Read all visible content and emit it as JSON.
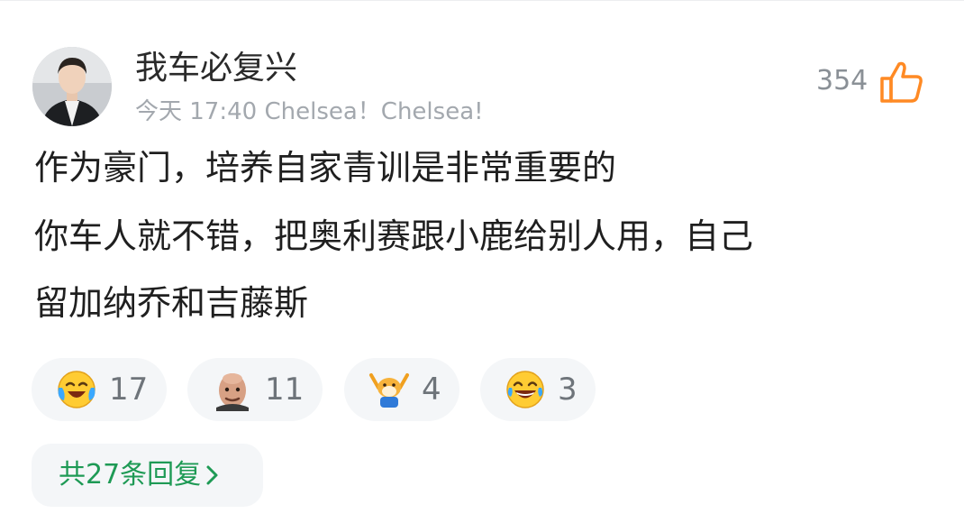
{
  "comment": {
    "author": "我车必复兴",
    "time": "今天 17:40",
    "tagline": "Chelsea！Chelsea!",
    "likes": "354",
    "lines": [
      "作为豪门，培养自家青训是非常重要的",
      "你车人就不错，把奥利赛跟小鹿给别人用，自己",
      "留加纳乔和吉藤斯"
    ]
  },
  "reactions": [
    {
      "icon": "laughing-cry-emoji-icon",
      "count": "17"
    },
    {
      "icon": "bald-man-face-sticker-icon",
      "count": "11"
    },
    {
      "icon": "cheering-dog-sticker-icon",
      "count": "4"
    },
    {
      "icon": "tears-of-joy-emoji-icon",
      "count": "3"
    }
  ],
  "replies_label": "共27条回复",
  "colors": {
    "accent_orange": "#ff8a24",
    "reply_green": "#1e9a55",
    "pill_bg": "#f4f6f8"
  }
}
